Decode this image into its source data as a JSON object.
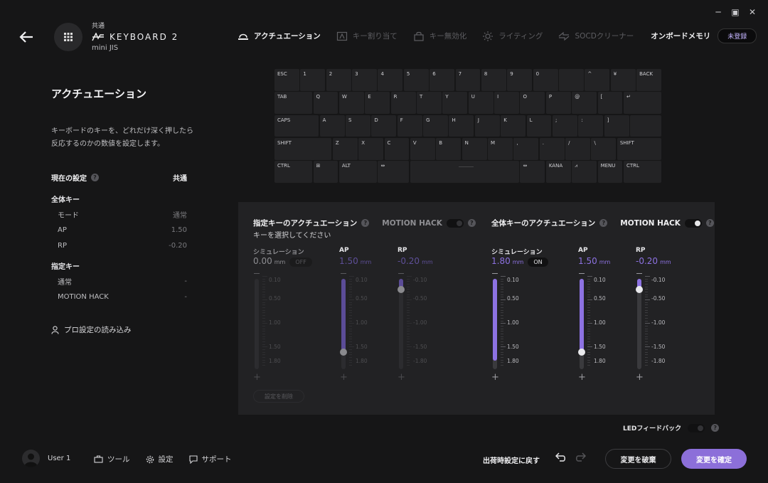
{
  "device": {
    "profile": "共通",
    "name": "KEYBOARD 2",
    "layout": "mini JIS"
  },
  "tabs": [
    {
      "label": "アクチュエーション",
      "icon": "actuation-icon",
      "active": true
    },
    {
      "label": "キー割り当て",
      "icon": "key-assign-icon",
      "active": false
    },
    {
      "label": "キー無効化",
      "icon": "lock-icon",
      "active": false
    },
    {
      "label": "ライティング",
      "icon": "lighting-icon",
      "active": false
    },
    {
      "label": "SOCDクリーナー",
      "icon": "socd-icon",
      "active": false
    }
  ],
  "onboard": {
    "label": "オンボードメモリ",
    "badge": "未登録"
  },
  "left_panel": {
    "title": "アクチュエーション",
    "description": "キーボードのキーを、どれだけ深く押したら反応するのかの数値を設定します。",
    "current": {
      "label": "現在の設定",
      "value": "共通"
    },
    "all_keys": {
      "label": "全体キー",
      "rows": [
        {
          "label": "モード",
          "value": "通常"
        },
        {
          "label": "AP",
          "value": "1.50"
        },
        {
          "label": "RP",
          "value": "-0.20"
        }
      ]
    },
    "specific_keys": {
      "label": "指定キー",
      "rows": [
        {
          "label": "通常",
          "value": "-"
        },
        {
          "label": "MOTION HACK",
          "value": "-"
        }
      ]
    },
    "pro_settings": "プロ設定の読み込み"
  },
  "keyboard": {
    "rows": [
      [
        "ESC",
        "1",
        "2",
        "3",
        "4",
        "5",
        "6",
        "7",
        "8",
        "9",
        "0",
        "",
        "^",
        "¥",
        "BACK"
      ],
      [
        "TAB",
        "Q",
        "W",
        "E",
        "R",
        "T",
        "Y",
        "U",
        "I",
        "O",
        "P",
        "@",
        "[",
        "↵"
      ],
      [
        "CAPS",
        "A",
        "S",
        "D",
        "F",
        "G",
        "H",
        "J",
        "K",
        "L",
        ";",
        ":",
        "]"
      ],
      [
        "SHIFT",
        "Z",
        "X",
        "C",
        "V",
        "B",
        "N",
        "M",
        ",",
        ".",
        "/",
        "\\",
        "SHIFT"
      ],
      [
        "CTRL",
        "⊞",
        "ALT",
        "⇔",
        "",
        "⇔",
        "KANA",
        "⩘",
        "MENU",
        "CTRL"
      ]
    ]
  },
  "specific_actuation": {
    "title": "指定キーのアクチュエーション",
    "motion_hack": "MOTION HACK",
    "prompt": "キーを選択してください",
    "simulation": {
      "label": "シミュレーション",
      "value": "0.00",
      "unit": "mm",
      "state": "OFF"
    },
    "ap": {
      "label": "AP",
      "value": "1.50",
      "unit": "mm"
    },
    "rp": {
      "label": "RP",
      "value": "-0.20",
      "unit": "mm"
    },
    "delete_label": "設定を削除"
  },
  "global_actuation": {
    "title": "全体キーのアクチュエーション",
    "motion_hack": "MOTION HACK",
    "simulation": {
      "label": "シミュレーション",
      "value": "1.80",
      "unit": "mm",
      "state": "ON"
    },
    "ap": {
      "label": "AP",
      "value": "1.50",
      "unit": "mm"
    },
    "rp": {
      "label": "RP",
      "value": "-0.20",
      "unit": "mm"
    }
  },
  "scales": {
    "sim": [
      "0.10",
      "0.50",
      "1.00",
      "1.50",
      "1.80"
    ],
    "ap": [
      "0.10",
      "0.50",
      "1.00",
      "1.50",
      "1.80"
    ],
    "rp": [
      "-0.10",
      "-0.50",
      "-1.00",
      "-1.50",
      "-1.80"
    ]
  },
  "led_feedback": "LEDフィードバック",
  "footer": {
    "user": "User 1",
    "tools": "ツール",
    "settings": "設定",
    "support": "サポート",
    "reset": "出荷時設定に戻す",
    "discard": "変更を破棄",
    "confirm": "変更を確定"
  },
  "colors": {
    "accent": "#8c6fd9",
    "background": "#161617",
    "panel": "#222224"
  }
}
